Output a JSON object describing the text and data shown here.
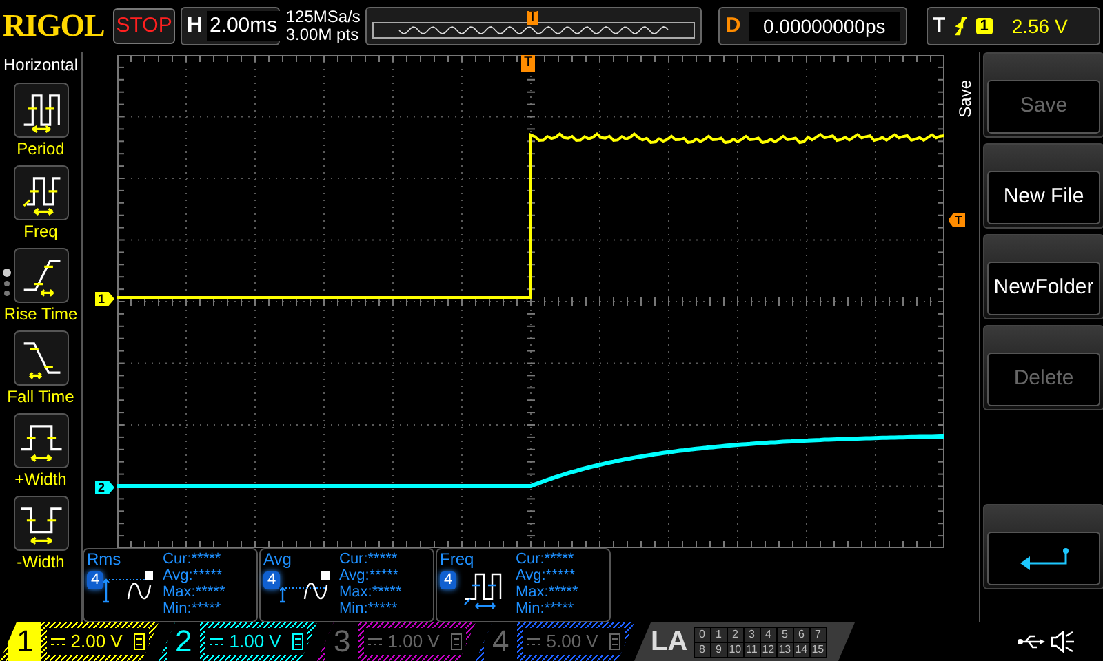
{
  "brand": "RIGOL",
  "run_state": {
    "label": "STOP",
    "kind": "stop"
  },
  "timebase": {
    "label": "H",
    "value": "2.00ms"
  },
  "sample": {
    "rate": "125MSa/s",
    "depth": "3.00M pts"
  },
  "delay": {
    "label": "D",
    "value": "0.00000000ps"
  },
  "trigger": {
    "label": "T",
    "source": "1",
    "level": "2.56 V",
    "overview_marker": "T",
    "position_marker": "T",
    "level_marker": "T"
  },
  "left_menu": {
    "title": "Horizontal",
    "items": [
      {
        "label": "Period",
        "kind": "period"
      },
      {
        "label": "Freq",
        "kind": "freq"
      },
      {
        "label": "Rise Time",
        "kind": "rise"
      },
      {
        "label": "Fall Time",
        "kind": "fall"
      },
      {
        "label": "+Width",
        "kind": "pwidth"
      },
      {
        "label": "-Width",
        "kind": "nwidth"
      }
    ],
    "pages": [
      {
        "selected": true
      },
      {
        "selected": false
      },
      {
        "selected": false
      }
    ]
  },
  "markers": [
    {
      "label": "1"
    },
    {
      "label": "2"
    }
  ],
  "measurements": [
    {
      "name": "Rms",
      "source": "4",
      "kind": "rms",
      "rows": [
        "Cur:*****",
        "Avg:*****",
        "Max:*****",
        "Min:*****"
      ]
    },
    {
      "name": "Avg",
      "source": "4",
      "kind": "avg",
      "rows": [
        "Cur:*****",
        "Avg:*****",
        "Max:*****",
        "Min:*****"
      ]
    },
    {
      "name": "Freq",
      "source": "4",
      "kind": "freq",
      "rows": [
        "Cur:*****",
        "Avg:*****",
        "Max:*****",
        "Min:*****"
      ]
    }
  ],
  "right_menu": {
    "title": "Save",
    "buttons": [
      {
        "kind": "text",
        "label": "Save",
        "disabled": true
      },
      {
        "kind": "text",
        "label": "New File",
        "disabled": false
      },
      {
        "kind": "text",
        "label": "NewFolder",
        "disabled": false
      },
      {
        "kind": "text",
        "label": "Delete",
        "disabled": true
      },
      {
        "kind": "back"
      }
    ]
  },
  "channels": [
    {
      "number": "1",
      "scale": "2.00 V",
      "color": "#ffff00",
      "on": true,
      "selected": true
    },
    {
      "number": "2",
      "scale": "1.00 V",
      "color": "#00ffff",
      "on": true,
      "selected": false
    },
    {
      "number": "3",
      "scale": "1.00 V",
      "color": "#c000c0",
      "on": false,
      "selected": false
    },
    {
      "number": "4",
      "scale": "5.00 V",
      "color": "#1e60ff",
      "on": false,
      "selected": false
    }
  ],
  "la": {
    "label": "LA",
    "bits": [
      "0",
      "1",
      "2",
      "3",
      "4",
      "5",
      "6",
      "7",
      "8",
      "9",
      "10",
      "11",
      "12",
      "13",
      "14",
      "15"
    ]
  }
}
